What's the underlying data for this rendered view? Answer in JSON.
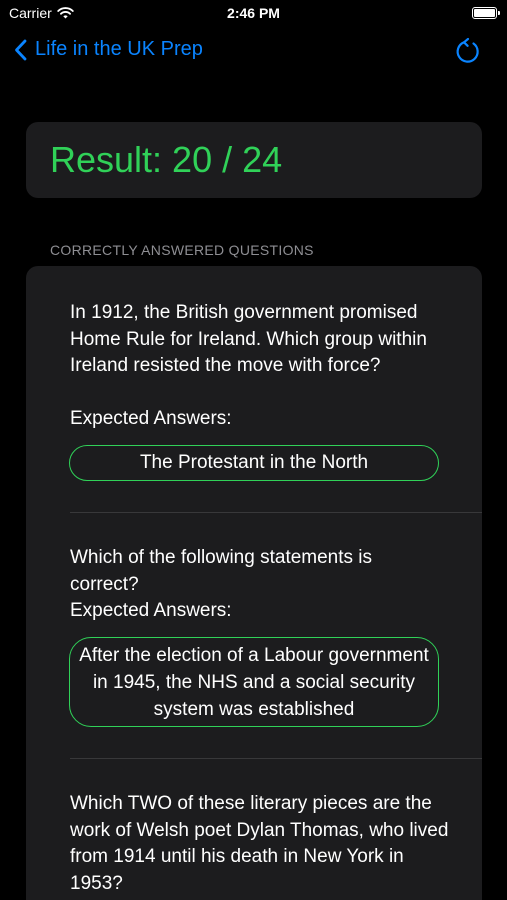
{
  "status_bar": {
    "carrier": "Carrier",
    "time": "2:46 PM"
  },
  "nav": {
    "back_label": "Life in the UK Prep",
    "accent_color": "#0a84ff"
  },
  "result": {
    "text": "Result: 20 / 24",
    "color": "#30d158"
  },
  "section": {
    "header": "CORRECTLY ANSWERED QUESTIONS"
  },
  "questions": [
    {
      "question": "In 1912, the British government promised Home Rule for Ireland. Which group within Ireland resisted the move with force?",
      "expected_label": "Expected Answers:",
      "answers": [
        "The Protestant in the North"
      ]
    },
    {
      "question": "Which of the following statements is correct?",
      "expected_label": "Expected Answers:",
      "answers": [
        "After the election of a Labour government in 1945, the NHS and a social security system was established"
      ]
    },
    {
      "question": "Which TWO of these literary pieces are the work of Welsh poet Dylan Thomas, who lived from 1914 until his death in New York in 1953?"
    }
  ],
  "icons": {
    "back": "chevron-left-icon",
    "refresh": "refresh-icon",
    "wifi": "wifi-icon",
    "battery": "battery-icon"
  }
}
